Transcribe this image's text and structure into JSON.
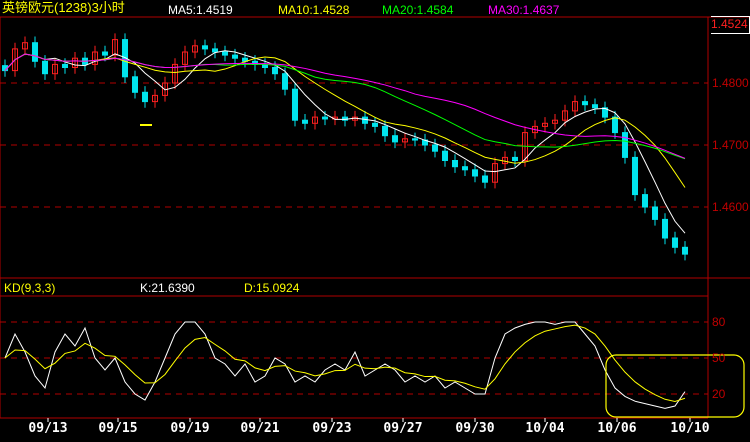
{
  "header": {
    "title": "英镑欧元(1238)3小时",
    "ma5": "MA5:1.4519",
    "ma10": "MA10:1.4528",
    "ma20": "MA20:1.4584",
    "ma30": "MA30:1.4637",
    "last_price": "1.4524"
  },
  "kd_header": {
    "title": "KD(9,3,3)",
    "k": "K:21.6390",
    "d": "D:15.0924"
  },
  "colors": {
    "up": "#ff2020",
    "down": "#00e5ee",
    "ma5": "#ffffff",
    "ma10": "#ffff00",
    "ma20": "#00ff00",
    "ma30": "#ff00ff",
    "grid": "#b00000",
    "k": "#ffffff",
    "d": "#ffff00",
    "annotation": "#ffff00"
  },
  "chart_data": [
    {
      "type": "candlestick",
      "title": "英镑欧元(1238)3小时",
      "ylim": [
        1.45,
        1.4906
      ],
      "yticks": [
        "1.4800",
        "1.4700",
        "1.4600"
      ],
      "closes": [
        1.482,
        1.4855,
        1.4865,
        1.4835,
        1.4815,
        1.483,
        1.4825,
        1.484,
        1.483,
        1.485,
        1.4845,
        1.487,
        1.481,
        1.4785,
        1.477,
        1.478,
        1.48,
        1.483,
        1.485,
        1.486,
        1.4855,
        1.485,
        1.4845,
        1.484,
        1.4835,
        1.483,
        1.4825,
        1.4815,
        1.479,
        1.474,
        1.4735,
        1.4745,
        1.4742,
        1.4745,
        1.474,
        1.4745,
        1.4735,
        1.473,
        1.4715,
        1.4705,
        1.471,
        1.4708,
        1.47,
        1.469,
        1.4675,
        1.4665,
        1.466,
        1.465,
        1.464,
        1.467,
        1.468,
        1.4675,
        1.472,
        1.473,
        1.4735,
        1.474,
        1.4755,
        1.477,
        1.4765,
        1.476,
        1.4745,
        1.472,
        1.468,
        1.462,
        1.46,
        1.458,
        1.455,
        1.4535,
        1.4524
      ],
      "moving_averages": [
        5,
        10,
        20,
        30
      ]
    },
    {
      "type": "line",
      "title": "KD(9,3,3)",
      "ylim": [
        0,
        100
      ],
      "yticks": [
        "80",
        "50",
        "20"
      ],
      "k": [
        50,
        70,
        55,
        35,
        25,
        55,
        70,
        60,
        75,
        50,
        40,
        50,
        30,
        20,
        15,
        30,
        50,
        70,
        80,
        80,
        70,
        50,
        45,
        35,
        45,
        30,
        35,
        50,
        45,
        30,
        35,
        30,
        40,
        45,
        40,
        55,
        35,
        40,
        45,
        40,
        30,
        35,
        30,
        35,
        25,
        30,
        25,
        20,
        20,
        50,
        70,
        75,
        78,
        80,
        80,
        78,
        80,
        80,
        70,
        60,
        40,
        25,
        18,
        14,
        12,
        10,
        8,
        10,
        22
      ]
    }
  ],
  "x_axis": {
    "dates": [
      "09/13",
      "09/15",
      "09/19",
      "09/21",
      "09/23",
      "09/27",
      "09/30",
      "10/04",
      "10/06",
      "10/10"
    ]
  }
}
